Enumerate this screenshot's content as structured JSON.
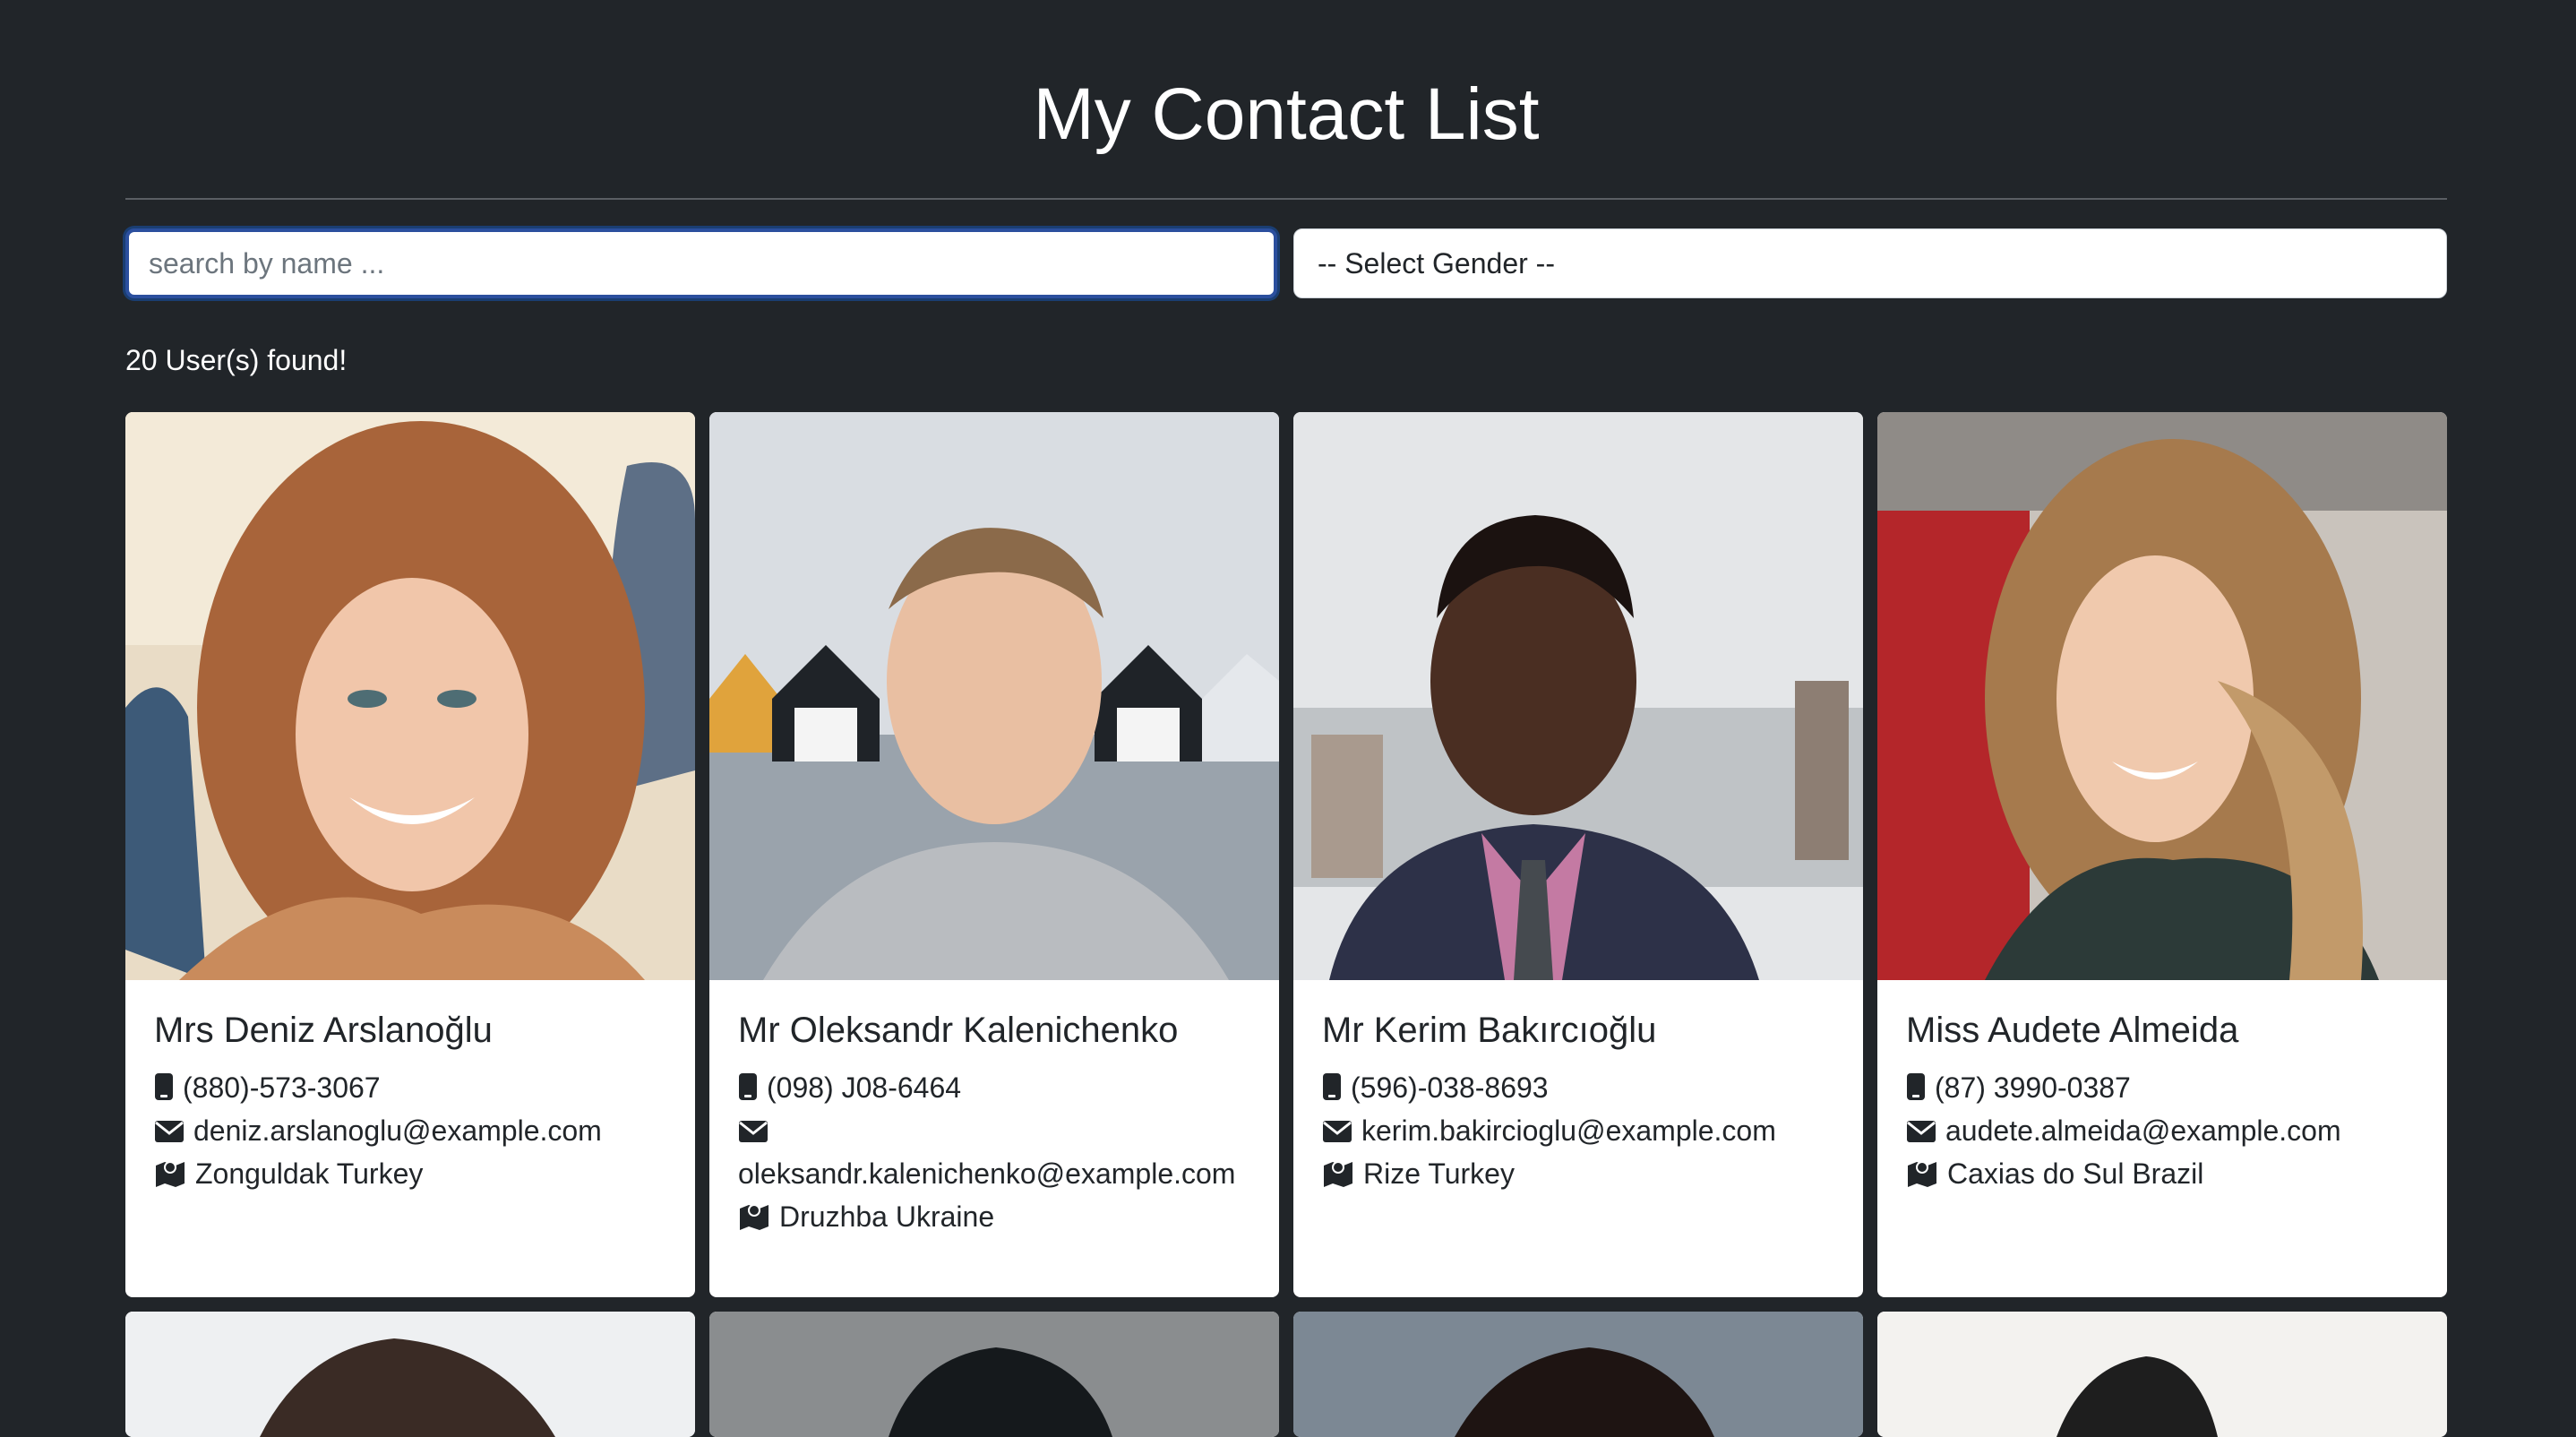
{
  "page": {
    "title": "My Contact List"
  },
  "filters": {
    "search_placeholder": "search by name ...",
    "gender_selected": "-- Select Gender --"
  },
  "results": {
    "count_text": "20 User(s) found!"
  },
  "icons": {
    "phone": "mobile-phone-icon",
    "email": "envelope-icon",
    "location": "map-icon"
  },
  "colors": {
    "background": "#212529",
    "card": "#ffffff",
    "focus_border": "#2b4f9e"
  },
  "contacts": [
    {
      "name": "Mrs Deniz Arslanoğlu",
      "phone": "(880)-573-3067",
      "email": "deniz.arslanoglu@example.com",
      "location": "Zonguldak Turkey"
    },
    {
      "name": "Mr Oleksandr Kalenichenko",
      "phone": "(098) J08-6464",
      "email": "oleksandr.kalenichenko@example.com",
      "location": "Druzhba Ukraine"
    },
    {
      "name": "Mr Kerim Bakırcıoğlu",
      "phone": "(596)-038-8693",
      "email": "kerim.bakircioglu@example.com",
      "location": "Rize Turkey"
    },
    {
      "name": "Miss Audete Almeida",
      "phone": "(87) 3990-0387",
      "email": "audete.almeida@example.com",
      "location": "Caxias do Sul Brazil"
    }
  ]
}
